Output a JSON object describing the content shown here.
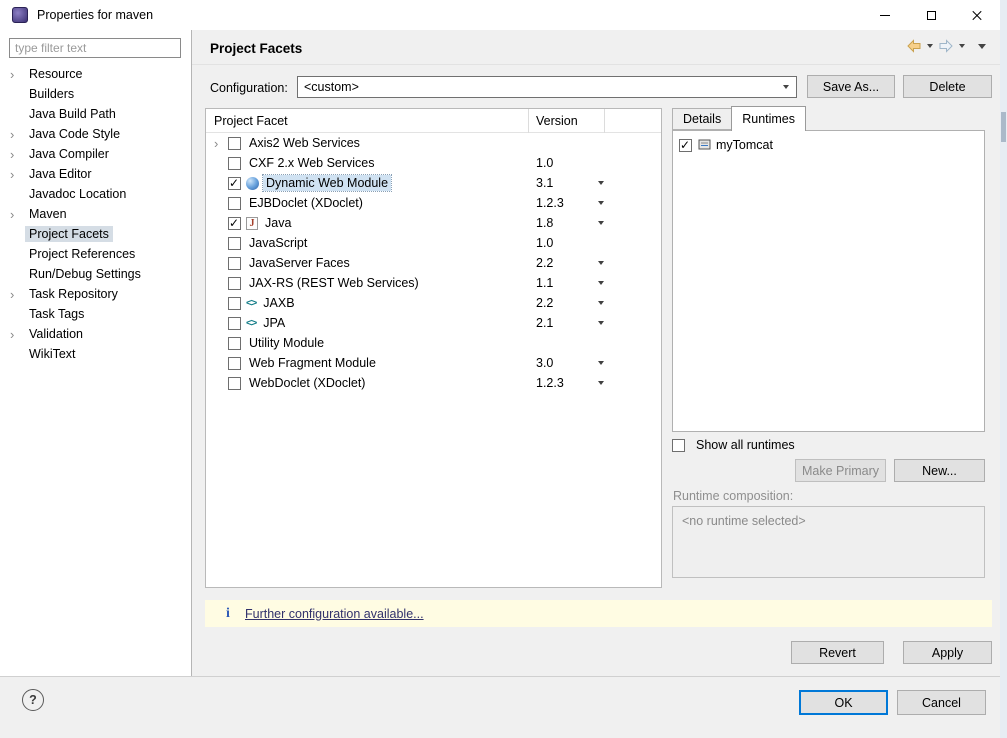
{
  "window": {
    "title": "Properties for maven"
  },
  "sidebar": {
    "filter_placeholder": "type filter text",
    "items": [
      {
        "label": "Resource"
      },
      {
        "label": "Builders"
      },
      {
        "label": "Java Build Path"
      },
      {
        "label": "Java Code Style"
      },
      {
        "label": "Java Compiler"
      },
      {
        "label": "Java Editor"
      },
      {
        "label": "Javadoc Location"
      },
      {
        "label": "Maven"
      },
      {
        "label": "Project Facets"
      },
      {
        "label": "Project References"
      },
      {
        "label": "Run/Debug Settings"
      },
      {
        "label": "Task Repository"
      },
      {
        "label": "Task Tags"
      },
      {
        "label": "Validation"
      },
      {
        "label": "WikiText"
      }
    ]
  },
  "page": {
    "title": "Project Facets"
  },
  "config": {
    "label": "Configuration:",
    "value": "<custom>",
    "save_as_label": "Save As...",
    "delete_label": "Delete"
  },
  "facets": {
    "columns": {
      "name": "Project Facet",
      "version": "Version"
    },
    "rows": [
      {
        "name": "Axis2 Web Services",
        "version": "",
        "checked": false
      },
      {
        "name": "CXF 2.x Web Services",
        "version": "1.0",
        "checked": false
      },
      {
        "name": "Dynamic Web Module",
        "version": "3.1",
        "checked": true
      },
      {
        "name": "EJBDoclet (XDoclet)",
        "version": "1.2.3",
        "checked": false
      },
      {
        "name": "Java",
        "version": "1.8",
        "checked": true
      },
      {
        "name": "JavaScript",
        "version": "1.0",
        "checked": false
      },
      {
        "name": "JavaServer Faces",
        "version": "2.2",
        "checked": false
      },
      {
        "name": "JAX-RS (REST Web Services)",
        "version": "1.1",
        "checked": false
      },
      {
        "name": "JAXB",
        "version": "2.2",
        "checked": false
      },
      {
        "name": "JPA",
        "version": "2.1",
        "checked": false
      },
      {
        "name": "Utility Module",
        "version": "",
        "checked": false
      },
      {
        "name": "Web Fragment Module",
        "version": "3.0",
        "checked": false
      },
      {
        "name": "WebDoclet (XDoclet)",
        "version": "1.2.3",
        "checked": false
      }
    ]
  },
  "runtimes": {
    "tab_details": "Details",
    "tab_runtimes": "Runtimes",
    "items": [
      {
        "name": "myTomcat",
        "checked": true
      }
    ],
    "show_all_label": "Show all runtimes",
    "make_primary_label": "Make Primary",
    "new_label": "New...",
    "composition_label": "Runtime composition:",
    "composition_placeholder": "<no runtime selected>"
  },
  "info": {
    "message": "Further configuration available..."
  },
  "actions": {
    "revert": "Revert",
    "apply": "Apply",
    "ok": "OK",
    "cancel": "Cancel"
  },
  "colors": {
    "accent": "#0078d7",
    "info_background": "#fffce3",
    "selection": "#d0e2f2"
  }
}
